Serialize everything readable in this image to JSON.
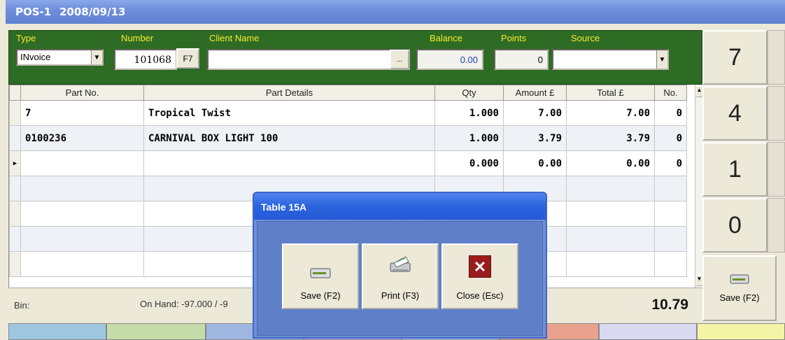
{
  "window": {
    "title": "POS-1",
    "date": "2008/09/13"
  },
  "header": {
    "labels": {
      "type": "Type",
      "number": "Number",
      "client_name": "Client Name",
      "balance": "Balance",
      "points": "Points",
      "source": "Source"
    },
    "type_value": "INvoice",
    "number_value": "101068",
    "f7_button": "F7",
    "client_name_value": "",
    "ellipsis_button": "...",
    "balance_value": "0.00",
    "points_value": "0",
    "source_value": ""
  },
  "grid": {
    "columns": [
      "Part No.",
      "Part Details",
      "Qty",
      "Amount £",
      "Total £",
      "No."
    ],
    "rows": [
      {
        "part_no": "7",
        "details": "Tropical Twist",
        "qty": "1.000",
        "amount": "7.00",
        "total": "7.00",
        "no": "0"
      },
      {
        "part_no": "0100236",
        "details": "CARNIVAL BOX LIGHT 100",
        "qty": "1.000",
        "amount": "3.79",
        "total": "3.79",
        "no": "0"
      },
      {
        "part_no": "",
        "details": "",
        "qty": "0.000",
        "amount": "0.00",
        "total": "0.00",
        "no": "0"
      }
    ]
  },
  "footer": {
    "bin_label": "Bin:",
    "on_hand": "On Hand: -97.000 / -9",
    "grand_total": "10.79"
  },
  "keypad": {
    "keys": [
      "7",
      "4",
      "1",
      "0"
    ],
    "save_label": "Save (F2)"
  },
  "dialog": {
    "title": "Table 15A",
    "buttons": {
      "save": "Save (F2)",
      "print": "Print (F3)",
      "close": "Close (Esc)"
    }
  },
  "colors": {
    "header_green": "#2e6b25",
    "label_yellow": "#f4ee2a",
    "dialog_blue": "#5f7fc8",
    "close_red": "#9b1c1c"
  },
  "icons": {
    "save": "printer-drive-icon",
    "print": "printer-icon",
    "close": "close-x-icon"
  }
}
